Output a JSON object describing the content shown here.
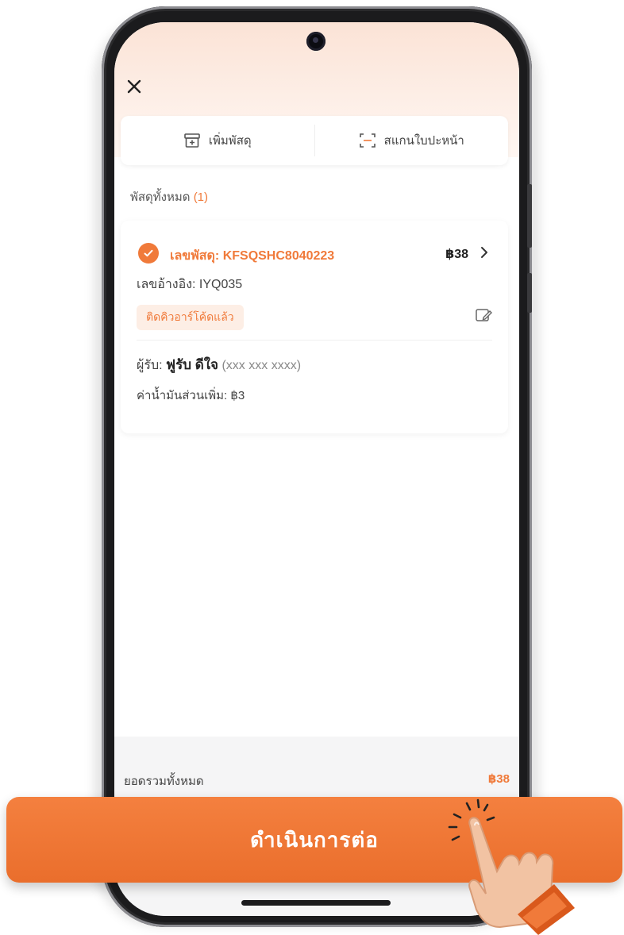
{
  "screen": {
    "close_icon": "close-icon",
    "actions": [
      {
        "label": "เพิ่มพัสดุ",
        "icon": "add-parcel-icon"
      },
      {
        "label": "สแกนใบปะหน้า",
        "icon": "scan-icon"
      }
    ],
    "section_title": "พัสดุทั้งหมด",
    "section_count": "(1)"
  },
  "parcel": {
    "number_label": "เลขพัสดุ: KFSQSHC8040223",
    "price": "฿38",
    "reference": "เลขอ้างอิง: IYQ035",
    "status_badge": "ติดคิวอาร์โค้ดแล้ว",
    "recipient_prefix": "ผู้รับ:",
    "recipient_name": "ฟูรับ ดีใจ",
    "recipient_phone": "(xxx xxx xxxx)",
    "fuel_surcharge": "ค่าน้ำมันส่วนเพิ่ม: ฿3"
  },
  "footer": {
    "total_label": "ยอดรวมทั้งหมด",
    "total_value": "฿38"
  },
  "proceed_button": "ดำเนินการต่อ",
  "colors": {
    "accent": "#f07a3a",
    "button": "#ee7431"
  }
}
